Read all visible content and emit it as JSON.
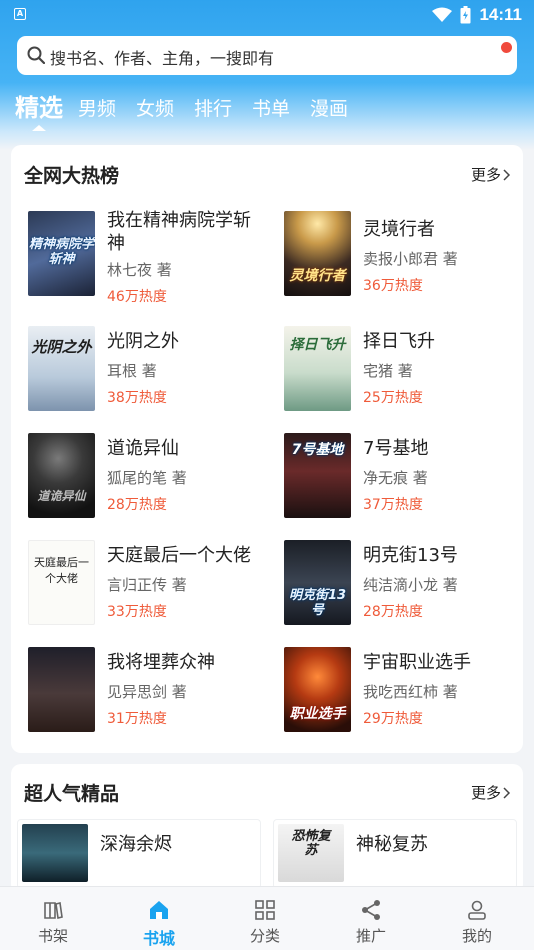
{
  "status_bar": {
    "time": "14:11",
    "app_icon_letter": "A"
  },
  "search": {
    "placeholder": "搜书名、作者、主角，一搜即有"
  },
  "tabs": [
    {
      "label": "精选",
      "active": true
    },
    {
      "label": "男频"
    },
    {
      "label": "女频"
    },
    {
      "label": "排行"
    },
    {
      "label": "书单"
    },
    {
      "label": "漫画"
    }
  ],
  "hot": {
    "title": "全网大热榜",
    "more": "更多",
    "books": [
      {
        "title": "我在精神病院学斩神",
        "author": "林七夜 著",
        "heat": "46万热度",
        "cover_text": "精神病院学斩神"
      },
      {
        "title": "灵境行者",
        "author": "卖报小郎君 著",
        "heat": "36万热度",
        "cover_text": "灵境行者"
      },
      {
        "title": "光阴之外",
        "author": "耳根 著",
        "heat": "38万热度",
        "cover_text": "光阴之外"
      },
      {
        "title": "择日飞升",
        "author": "宅猪 著",
        "heat": "25万热度",
        "cover_text": "择日飞升"
      },
      {
        "title": "道诡异仙",
        "author": "狐尾的笔 著",
        "heat": "28万热度",
        "cover_text": "道诡异仙"
      },
      {
        "title": "7号基地",
        "author": "净无痕 著",
        "heat": "37万热度",
        "cover_text": "7号基地"
      },
      {
        "title": "天庭最后一个大佬",
        "author": "言归正传 著",
        "heat": "33万热度",
        "cover_text": "天庭最后一个大佬"
      },
      {
        "title": "明克街13号",
        "author": "纯洁滴小龙 著",
        "heat": "28万热度",
        "cover_text": "明克街13号"
      },
      {
        "title": "我将埋葬众神",
        "author": "见异思剑 著",
        "heat": "31万热度",
        "cover_text": ""
      },
      {
        "title": "宇宙职业选手",
        "author": "我吃西红柿 著",
        "heat": "29万热度",
        "cover_text": "职业选手"
      }
    ]
  },
  "popular": {
    "title": "超人气精品",
    "more": "更多",
    "books": [
      {
        "title": "深海余烬"
      },
      {
        "title": "神秘复苏",
        "cover_text": "恐怖复苏"
      }
    ]
  },
  "bottom_nav": [
    {
      "label": "书架",
      "icon": "bookshelf-icon"
    },
    {
      "label": "书城",
      "icon": "home-icon",
      "active": true
    },
    {
      "label": "分类",
      "icon": "category-grid-icon"
    },
    {
      "label": "推广",
      "icon": "share-icon"
    },
    {
      "label": "我的",
      "icon": "user-icon"
    }
  ],
  "colors": {
    "accent": "#1aa3ef",
    "heat": "#ef5b3a",
    "badge": "#f04a3c"
  }
}
